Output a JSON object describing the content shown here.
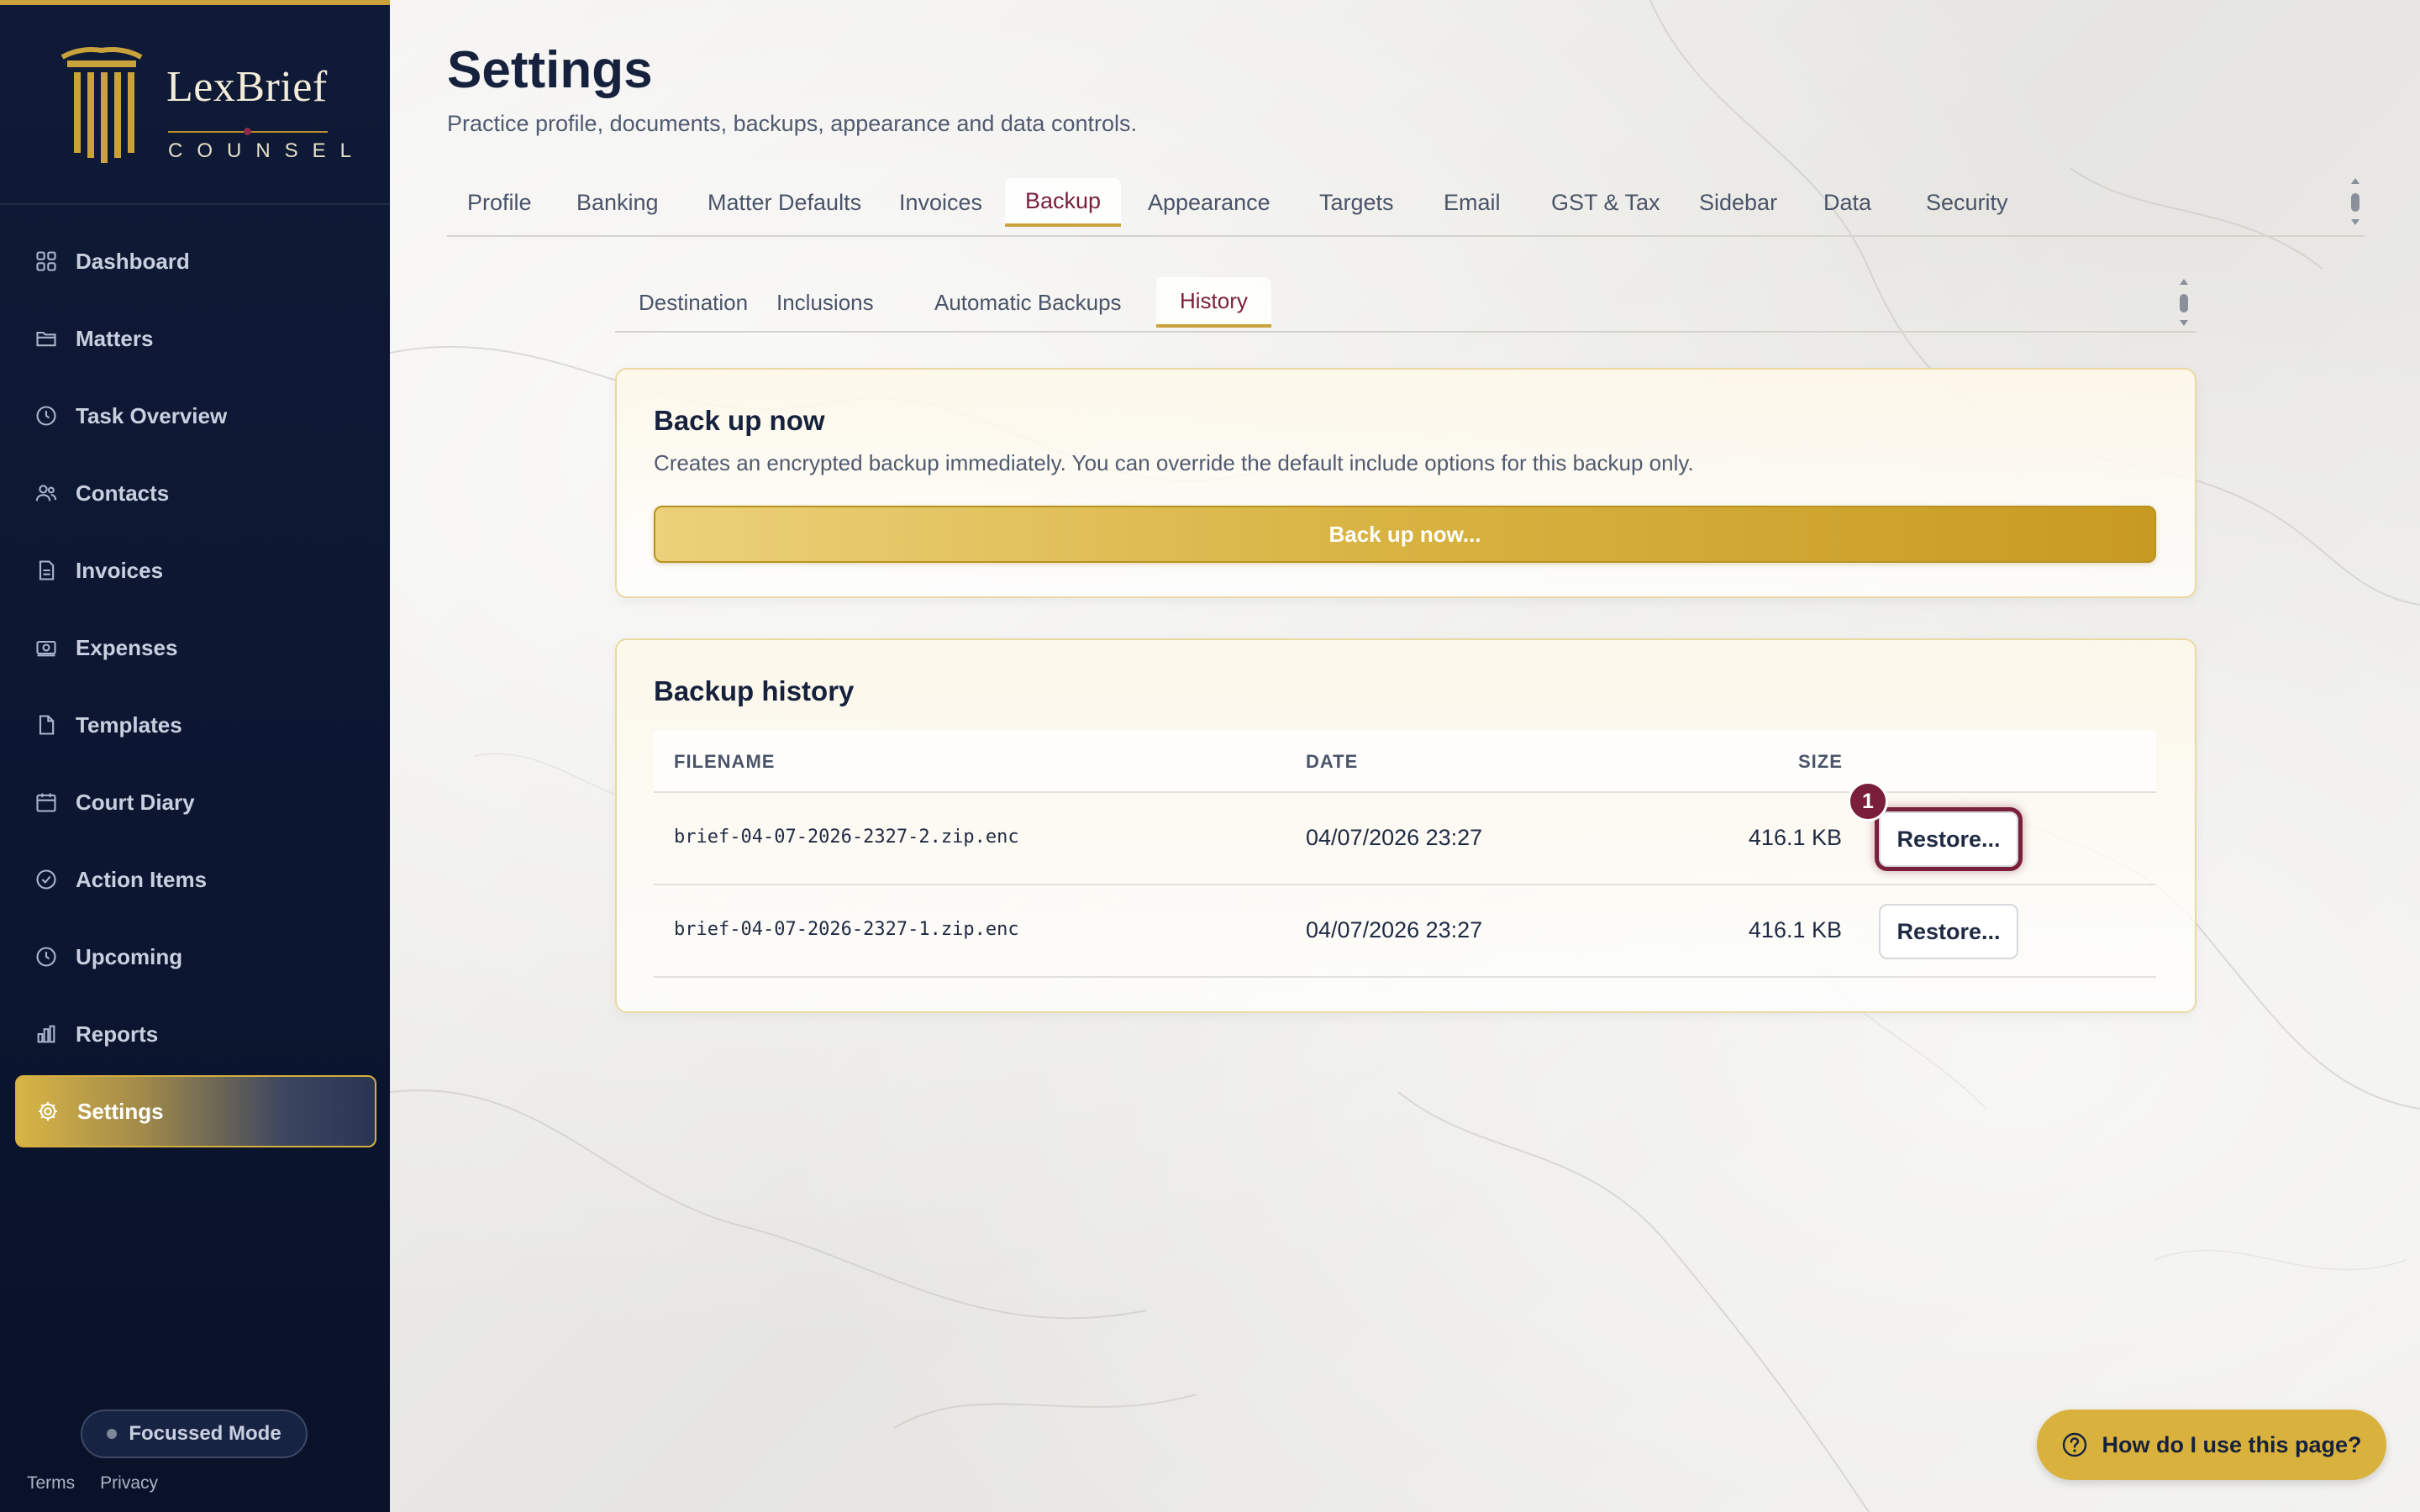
{
  "brand": {
    "name": "LexBrief",
    "sub": "COUNSEL"
  },
  "sidebar": {
    "items": [
      {
        "label": "Dashboard",
        "icon": "dashboard-icon"
      },
      {
        "label": "Matters",
        "icon": "folder-icon"
      },
      {
        "label": "Task Overview",
        "icon": "clock-icon"
      },
      {
        "label": "Contacts",
        "icon": "users-icon"
      },
      {
        "label": "Invoices",
        "icon": "invoice-icon"
      },
      {
        "label": "Expenses",
        "icon": "cash-icon"
      },
      {
        "label": "Templates",
        "icon": "file-icon"
      },
      {
        "label": "Court Diary",
        "icon": "calendar-icon"
      },
      {
        "label": "Action Items",
        "icon": "check-circle-icon"
      },
      {
        "label": "Upcoming",
        "icon": "clock-icon"
      },
      {
        "label": "Reports",
        "icon": "bar-chart-icon"
      },
      {
        "label": "Settings",
        "icon": "gear-icon",
        "active": true
      }
    ],
    "focus_mode": "Focussed Mode",
    "footer": {
      "terms": "Terms",
      "privacy": "Privacy"
    }
  },
  "header": {
    "title": "Settings",
    "subtitle": "Practice profile, documents, backups, appearance and data controls."
  },
  "tabs": [
    "Profile",
    "Banking",
    "Matter Defaults",
    "Invoices",
    "Backup",
    "Appearance",
    "Targets",
    "Email",
    "GST & Tax",
    "Sidebar",
    "Data",
    "Security"
  ],
  "active_tab": "Backup",
  "subtabs": [
    "Destination",
    "Inclusions",
    "Automatic Backups",
    "History"
  ],
  "active_subtab": "History",
  "backup_now": {
    "title": "Back up now",
    "description": "Creates an encrypted backup immediately. You can override the default include options for this backup only.",
    "button": "Back up now..."
  },
  "history": {
    "title": "Backup history",
    "columns": {
      "filename": "FILENAME",
      "date": "DATE",
      "size": "SIZE"
    },
    "rows": [
      {
        "filename": "brief-04-07-2026-2327-2.zip.enc",
        "date": "04/07/2026 23:27",
        "size": "416.1 KB",
        "action": "Restore...",
        "badge": "1"
      },
      {
        "filename": "brief-04-07-2026-2327-1.zip.enc",
        "date": "04/07/2026 23:27",
        "size": "416.1 KB",
        "action": "Restore..."
      }
    ]
  },
  "help": {
    "label": "How do I use this page?"
  },
  "colors": {
    "navy": "#0f1a36",
    "gold": "#d9b545",
    "burgundy": "#7a1f3a"
  }
}
